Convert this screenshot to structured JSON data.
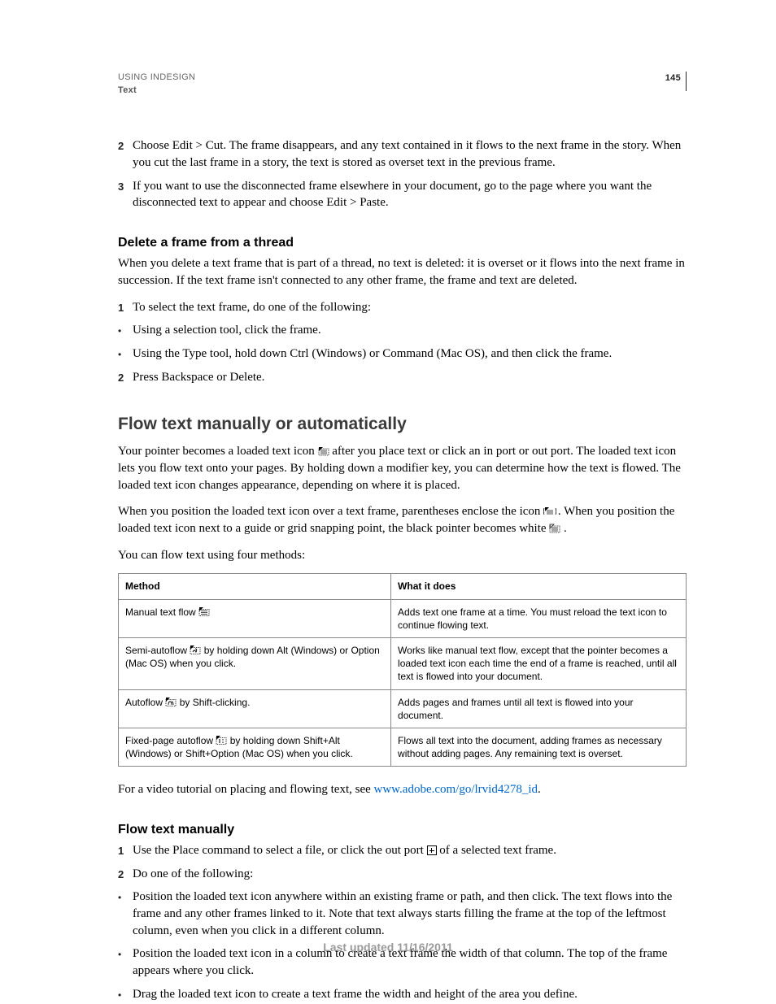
{
  "header": {
    "title": "USING INDESIGN",
    "section": "Text",
    "page": "145"
  },
  "top_steps": [
    {
      "n": "2",
      "text": "Choose Edit > Cut. The frame disappears, and any text contained in it flows to the next frame in the story. When you cut the last frame in a story, the text is stored as overset text in the previous frame."
    },
    {
      "n": "3",
      "text": "If you want to use the disconnected frame elsewhere in your document, go to the page where you want the disconnected text to appear and choose Edit > Paste."
    }
  ],
  "delete_heading": "Delete a frame from a thread",
  "delete_intro": "When you delete a text frame that is part of a thread, no text is deleted: it is overset or it flows into the next frame in succession. If the text frame isn't connected to any other frame, the frame and text are deleted.",
  "delete_steps": [
    {
      "n": "1",
      "text": "To select the text frame, do one of the following:"
    }
  ],
  "delete_bullets": [
    "Using a selection tool, click the frame.",
    "Using the Type tool, hold down Ctrl (Windows) or Command (Mac OS), and then click the frame."
  ],
  "delete_step2": {
    "n": "2",
    "text": "Press Backspace or Delete."
  },
  "flow_heading": "Flow text manually or automatically",
  "flow_p1a": "Your pointer becomes a loaded text icon ",
  "flow_p1b": " after you place text or click an in port or out port. The loaded text icon lets you flow text onto your pages. By holding down a modifier key, you can determine how the text is flowed. The loaded text icon changes appearance, depending on where it is placed.",
  "flow_p2a": "When you position the loaded text icon over a text frame, parentheses enclose the icon ",
  "flow_p2b": ". When you position the loaded text icon next to a guide or grid snapping point, the black pointer becomes white ",
  "flow_p2c": ".",
  "flow_p3": "You can flow text using four methods:",
  "table": {
    "head": [
      "Method",
      "What it does"
    ],
    "rows": [
      {
        "method_a": "Manual text flow ",
        "method_b": "",
        "desc": "Adds text one frame at a time. You must reload the text icon to continue flowing text."
      },
      {
        "method_a": "Semi-autoflow ",
        "method_b": " by holding down Alt (Windows) or Option (Mac OS) when you click.",
        "desc": "Works like manual text flow, except that the pointer becomes a loaded text icon each time the end of a frame is reached, until all text is flowed into your document."
      },
      {
        "method_a": "Autoflow ",
        "method_b": " by Shift-clicking.",
        "desc": "Adds pages and frames until all text is flowed into your document."
      },
      {
        "method_a": "Fixed-page autoflow ",
        "method_b": " by holding down Shift+Alt (Windows) or Shift+Option (Mac OS) when you click.",
        "desc": "Flows all text into the document, adding frames as necessary without adding pages. Any remaining text is overset."
      }
    ]
  },
  "video_text": "For a video tutorial on placing and flowing text, see ",
  "video_link": "www.adobe.com/go/lrvid4278_id",
  "video_after": ".",
  "manual_heading": "Flow text manually",
  "manual_step1a": "Use the Place command to select a file, or click the out port ",
  "manual_step1b": " of a selected text frame.",
  "manual_step2": {
    "n": "2",
    "text": "Do one of the following:"
  },
  "manual_bullets": [
    "Position the loaded text icon anywhere within an existing frame or path, and then click. The text flows into the frame and any other frames linked to it. Note that text always starts filling the frame at the top of the leftmost column, even when you click in a different column.",
    "Position the loaded text icon in a column to create a text frame the width of that column. The top of the frame appears where you click.",
    "Drag the loaded text icon to create a text frame the width and height of the area you define."
  ],
  "footer": "Last updated 11/16/2011"
}
